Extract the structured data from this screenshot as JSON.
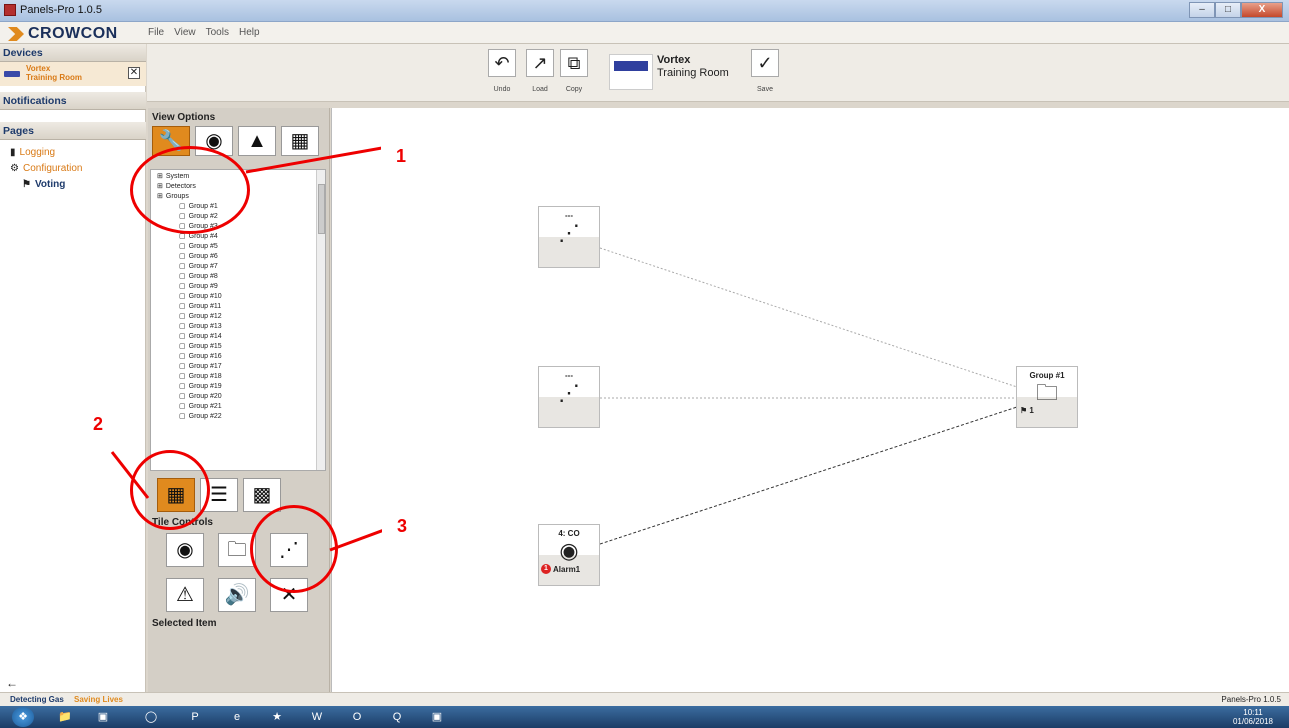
{
  "window": {
    "title": "Panels-Pro 1.0.5",
    "min": "–",
    "max": "□",
    "close": "X"
  },
  "brand": {
    "name": "CROWCON"
  },
  "menu": [
    "File",
    "View",
    "Tools",
    "Help"
  ],
  "left": {
    "devices_header": "Devices",
    "device": {
      "line1": "Vortex",
      "line2": "Training Room",
      "close": "✕"
    },
    "notifications_header": "Notifications",
    "pages_header": "Pages",
    "pages": [
      {
        "label": "Logging",
        "icon": "notes-icon"
      },
      {
        "label": "Configuration",
        "icon": "gear-icon"
      },
      {
        "label": "Voting",
        "icon": "flag-icon"
      }
    ],
    "back": "←"
  },
  "toolbar": {
    "undo": "Undo",
    "load": "Load",
    "copy": "Copy",
    "save": "Save",
    "device_name": "Vortex",
    "device_location": "Training Room"
  },
  "view_options": {
    "label": "View Options",
    "tile_controls": "Tile Controls",
    "selected_item": "Selected Item"
  },
  "tree": {
    "roots": [
      "System",
      "Detectors",
      "Groups"
    ],
    "groups": [
      "Group #1",
      "Group #2",
      "Group #3",
      "Group #4",
      "Group #5",
      "Group #6",
      "Group #7",
      "Group #8",
      "Group #9",
      "Group #10",
      "Group #11",
      "Group #12",
      "Group #13",
      "Group #14",
      "Group #15",
      "Group #16",
      "Group #17",
      "Group #18",
      "Group #19",
      "Group #20",
      "Group #21",
      "Group #22"
    ]
  },
  "canvas": {
    "nodes": [
      {
        "label": "---",
        "kind": "voting"
      },
      {
        "label": "---",
        "kind": "voting"
      },
      {
        "label": "4: CO",
        "kind": "detector",
        "badge": "1",
        "footer": "Alarm1"
      },
      {
        "label": "Group #1",
        "kind": "group",
        "footer": "1"
      }
    ]
  },
  "annotations": [
    "1",
    "2",
    "3"
  ],
  "status": {
    "left_a": "Detecting Gas",
    "left_b": "Saving Lives",
    "right": "Panels-Pro 1.0.5"
  },
  "taskbar": {
    "time": "10:11",
    "date": "01/06/2018"
  },
  "colors": {
    "accent": "#e08a1e",
    "navy": "#1d3a6b",
    "annotation": "#e00000"
  }
}
